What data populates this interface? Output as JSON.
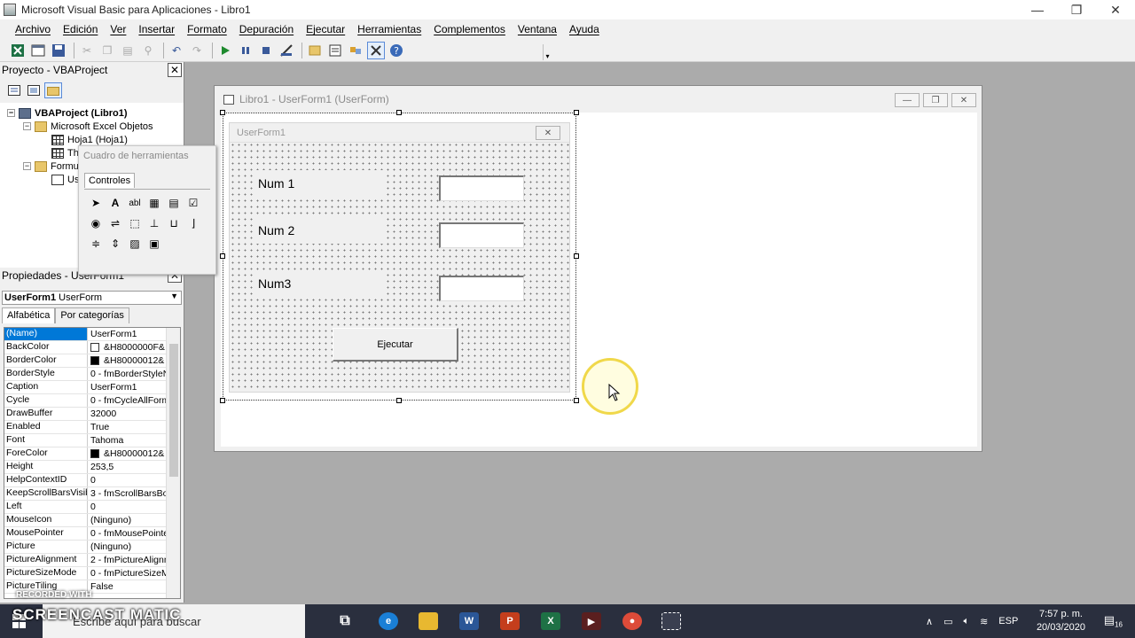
{
  "window": {
    "title": "Microsoft Visual Basic para Aplicaciones - Libro1",
    "minimize": "—",
    "maximize": "❐",
    "close": "✕"
  },
  "menu": [
    "Archivo",
    "Edición",
    "Ver",
    "Insertar",
    "Formato",
    "Depuración",
    "Ejecutar",
    "Herramientas",
    "Complementos",
    "Ventana",
    "Ayuda"
  ],
  "project_pane": {
    "title": "Proyecto - VBAProject",
    "close": "✕",
    "tree": [
      {
        "label": "VBAProject (Libro1)",
        "level": 0,
        "expander": "−",
        "icon": "project-icon"
      },
      {
        "label": "Microsoft Excel Objetos",
        "level": 1,
        "expander": "−",
        "icon": "folder-icon"
      },
      {
        "label": "Hoja1 (Hoja1)",
        "level": 2,
        "expander": "",
        "icon": "sheet-icon"
      },
      {
        "label": "Th",
        "level": 2,
        "expander": "",
        "icon": "workbook-icon"
      },
      {
        "label": "Formu",
        "level": 1,
        "expander": "−",
        "icon": "folder-icon"
      },
      {
        "label": "Us",
        "level": 2,
        "expander": "",
        "icon": "form-icon"
      }
    ]
  },
  "properties_pane": {
    "title": "Propiedades - UserForm1",
    "close": "✕",
    "object_name": "UserForm1",
    "object_type": "UserForm",
    "tabs": [
      "Alfabética",
      "Por categorías"
    ],
    "rows": [
      {
        "name": "(Name)",
        "value": "UserForm1",
        "color": ""
      },
      {
        "name": "BackColor",
        "value": "&H8000000F&",
        "color": "#ffffff"
      },
      {
        "name": "BorderColor",
        "value": "&H80000012&",
        "color": "#000000"
      },
      {
        "name": "BorderStyle",
        "value": "0 - fmBorderStyleN",
        "color": ""
      },
      {
        "name": "Caption",
        "value": "UserForm1",
        "color": ""
      },
      {
        "name": "Cycle",
        "value": "0 - fmCycleAllForms",
        "color": ""
      },
      {
        "name": "DrawBuffer",
        "value": "32000",
        "color": ""
      },
      {
        "name": "Enabled",
        "value": "True",
        "color": ""
      },
      {
        "name": "Font",
        "value": "Tahoma",
        "color": ""
      },
      {
        "name": "ForeColor",
        "value": "&H80000012&",
        "color": "#000000"
      },
      {
        "name": "Height",
        "value": "253,5",
        "color": ""
      },
      {
        "name": "HelpContextID",
        "value": "0",
        "color": ""
      },
      {
        "name": "KeepScrollBarsVisible",
        "value": "3 - fmScrollBarsBot",
        "color": ""
      },
      {
        "name": "Left",
        "value": "0",
        "color": ""
      },
      {
        "name": "MouseIcon",
        "value": "(Ninguno)",
        "color": ""
      },
      {
        "name": "MousePointer",
        "value": "0 - fmMousePointer",
        "color": ""
      },
      {
        "name": "Picture",
        "value": "(Ninguno)",
        "color": ""
      },
      {
        "name": "PictureAlignment",
        "value": "2 - fmPictureAlignm",
        "color": ""
      },
      {
        "name": "PictureSizeMode",
        "value": "0 - fmPictureSizeMo",
        "color": ""
      },
      {
        "name": "PictureTiling",
        "value": "False",
        "color": ""
      }
    ]
  },
  "toolbox": {
    "title": "Cuadro de herramientas",
    "tab": "Controles"
  },
  "designer": {
    "title": "Libro1 - UserForm1 (UserForm)",
    "userform_caption": "UserForm1",
    "labels": [
      "Num 1",
      "Num 2",
      "Num3"
    ],
    "button": "Ejecutar"
  },
  "taskbar": {
    "search_placeholder": "Escribe aquí para buscar",
    "language": "ESP",
    "time": "7:57 p. m.",
    "date": "20/03/2020",
    "notifications": "16"
  },
  "watermark": {
    "recorded": "RECORDED WITH",
    "brand": "SCREENCAST  MATIC"
  },
  "colors": {
    "accent": "#0078d7",
    "taskbar": "#2a2f3e",
    "mdi_background": "#ababab"
  }
}
